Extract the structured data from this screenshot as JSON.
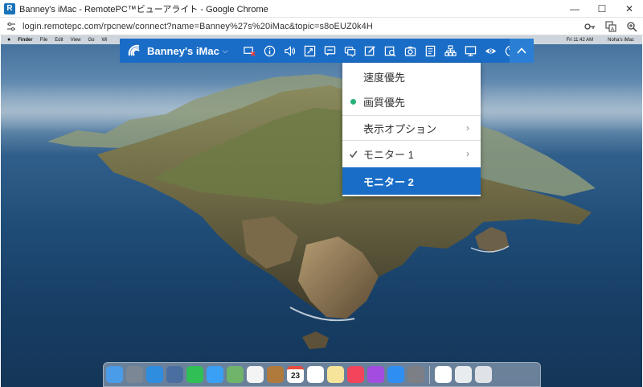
{
  "window": {
    "app_icon_letter": "R",
    "title": "Banney's iMac - RemotePC™ビューアライト - Google Chrome",
    "minimize": "—",
    "maximize": "☐",
    "close": "✕"
  },
  "addressbar": {
    "url": "login.remotepc.com/rpcnew/connect?name=Banney%27s%20iMac&topic=s8oEUZ0k4H",
    "icons": [
      "key-icon",
      "translate-icon",
      "zoom-icon"
    ]
  },
  "mac_menubar": {
    "apple": "",
    "items": [
      "Finder",
      "File",
      "Edit",
      "View",
      "Go",
      "Wi"
    ],
    "right": [
      "Fri 11:42 AM",
      "Noha's iMac"
    ]
  },
  "toolbar": {
    "computer_name": "Banney's iMac",
    "chevron": "⌵",
    "icons": [
      "disconnect-icon",
      "info-icon",
      "sound-icon",
      "fullscreen-icon",
      "chat-icon",
      "message-icon",
      "annotate-icon",
      "file-transfer-icon",
      "screenshot-icon",
      "notes-icon",
      "sitemap-icon",
      "display-icon",
      "view-icon",
      "help-icon"
    ],
    "collapse_icon": "chevron-up-icon",
    "accent": "#1a6dc6"
  },
  "dropdown": {
    "items": [
      {
        "label": "速度優先",
        "mark": "",
        "arrow": ""
      },
      {
        "label": "画質優先",
        "mark": "dot",
        "arrow": ""
      },
      {
        "label": "表示オプション",
        "mark": "",
        "arrow": "›"
      },
      {
        "label": "モニター 1",
        "mark": "check",
        "arrow": "›"
      },
      {
        "label": "モニター 2",
        "mark": "",
        "arrow": "",
        "active": true
      }
    ]
  },
  "dock": {
    "apps": [
      {
        "name": "finder",
        "color": "#4a9be8"
      },
      {
        "name": "launchpad",
        "color": "#7b8794"
      },
      {
        "name": "safari",
        "color": "#2f8ddf"
      },
      {
        "name": "photo-booth",
        "color": "#4a6ea0"
      },
      {
        "name": "facetime",
        "color": "#2fbf55"
      },
      {
        "name": "messages",
        "color": "#3aa0f5"
      },
      {
        "name": "maps",
        "color": "#6fb46a"
      },
      {
        "name": "photos",
        "color": "#f4f4f4"
      },
      {
        "name": "notes-book",
        "color": "#b07a3c"
      },
      {
        "name": "calendar",
        "color": "#ffffff"
      },
      {
        "name": "reminders",
        "color": "#ffffff"
      },
      {
        "name": "stickies",
        "color": "#f5e49a"
      },
      {
        "name": "music",
        "color": "#f2445b"
      },
      {
        "name": "podcasts",
        "color": "#a24de0"
      },
      {
        "name": "app-store",
        "color": "#2e8ef2"
      },
      {
        "name": "system-preferences",
        "color": "#7c7f85"
      },
      {
        "name": "chrome",
        "color": "#ffffff"
      },
      {
        "name": "documents",
        "color": "#e9ecef"
      },
      {
        "name": "trash",
        "color": "#dfe3e8"
      }
    ],
    "calendar_day": "23"
  }
}
